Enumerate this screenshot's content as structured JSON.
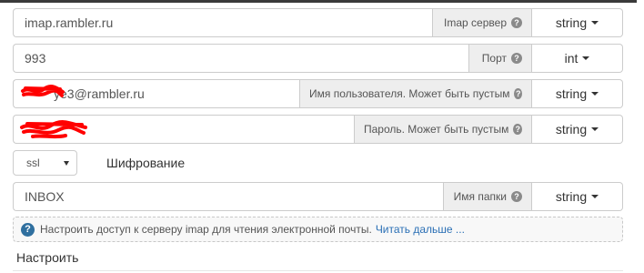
{
  "server": {
    "value": "imap.rambler.ru",
    "label": "Imap сервер",
    "type": "string"
  },
  "port": {
    "value": "993",
    "label": "Порт",
    "type": "int"
  },
  "username": {
    "value": "ye3@rambler.ru",
    "label": "Имя пользователя. Может быть пустым",
    "type": "string"
  },
  "password": {
    "value": "",
    "label": "Пароль. Может быть пустым",
    "type": "string"
  },
  "encryption": {
    "selected": "ssl",
    "label": "Шифрование"
  },
  "folder": {
    "value": "INBOX",
    "label": "Имя папки",
    "type": "string"
  },
  "help": {
    "icon": "question-icon",
    "text": "Настроить доступ к серверу imap для чтения электронной почты.",
    "link": "Читать дальше ..."
  },
  "configure_label": "Настроить",
  "colors": {
    "redaction": "#ff0000",
    "link": "#2a6fb5",
    "help_icon": "#2f6f9f"
  }
}
